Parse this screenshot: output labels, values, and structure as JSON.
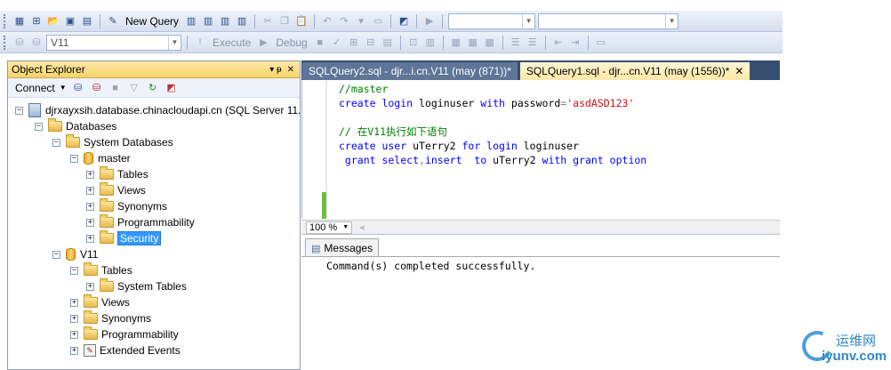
{
  "toolbar1": {
    "new_query": "New Query"
  },
  "toolbar2": {
    "database_combo": "V11",
    "execute": "Execute",
    "debug": "Debug"
  },
  "object_explorer": {
    "title": "Object Explorer",
    "pin": "▾ ᵽ",
    "close": "✕",
    "connect": "Connect",
    "tree": {
      "server": "djrxayxsih.database.chinacloudapi.cn (SQL Server 11.",
      "databases": "Databases",
      "system_databases": "System Databases",
      "master": "master",
      "master_tables": "Tables",
      "master_views": "Views",
      "master_synonyms": "Synonyms",
      "master_programmability": "Programmability",
      "master_security": "Security",
      "v11": "V11",
      "v11_tables": "Tables",
      "v11_system_tables": "System Tables",
      "v11_views": "Views",
      "v11_synonyms": "Synonyms",
      "v11_programmability": "Programmability",
      "v11_extended_events": "Extended Events"
    }
  },
  "tabs": {
    "query2": "SQLQuery2.sql - djr...i.cn.V11 (may (871))*",
    "query1": "SQLQuery1.sql - djr...cn.V11 (may (1556))*",
    "close": "✕"
  },
  "editor": {
    "line1": "//master",
    "line2_kw1": "create login",
    "line2_id": " loginuser ",
    "line2_kw2": "with",
    "line2_id2": " password",
    "line2_op": "=",
    "line2_str": "'asdASD123'",
    "line4": "// 在V11执行如下语句",
    "line5_kw1": "create user",
    "line5_id1": " uTerry2 ",
    "line5_kw2": "for login",
    "line5_id2": " loginuser",
    "line6_kw1": " grant select",
    "line6_op": ",",
    "line6_kw2": "insert",
    "line6_kw3": "  to",
    "line6_id": " uTerry2 ",
    "line6_kw4": "with grant option"
  },
  "zoom": {
    "value": "100 %"
  },
  "results": {
    "tab_label": "Messages",
    "message": "Command(s) completed successfully."
  },
  "watermark": {
    "line1": "运维网",
    "line2": "iyunv.com"
  }
}
